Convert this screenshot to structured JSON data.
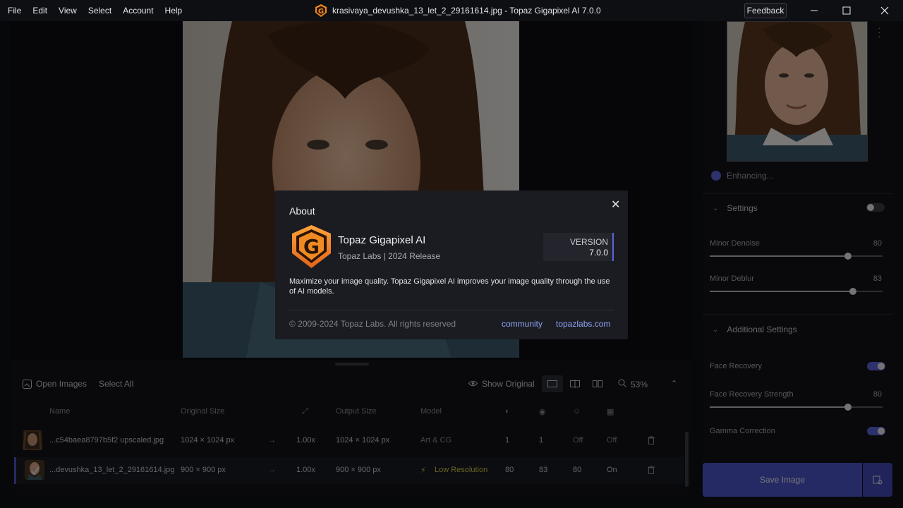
{
  "menu": [
    "File",
    "Edit",
    "View",
    "Select",
    "Account",
    "Help"
  ],
  "window": {
    "title": "krasivaya_devushka_13_let_2_29161614.jpg - Topaz Gigapixel AI 7.0.0",
    "feedback": "Feedback"
  },
  "colors": {
    "accent": "#5a63d8",
    "brand_orange": "#f08a22",
    "link": "#8ea4f5"
  },
  "right": {
    "status": "Enhancing...",
    "settings_title": "Settings",
    "minor_denoise": {
      "label": "Minor Denoise",
      "value": "80",
      "level": 0.8
    },
    "minor_deblur": {
      "label": "Minor Deblur",
      "value": "83",
      "level": 0.83
    },
    "additional_title": "Additional Settings",
    "face_recovery": {
      "label": "Face Recovery",
      "on": true
    },
    "face_strength": {
      "label": "Face Recovery Strength",
      "value": "80",
      "level": 0.8
    },
    "gamma": {
      "label": "Gamma Correction",
      "on": true
    },
    "save": "Save Image"
  },
  "bottom": {
    "open_images": "Open Images",
    "select_all": "Select All",
    "show_original": "Show Original",
    "zoom": "53%",
    "columns": {
      "name": "Name",
      "original": "Original Size",
      "output": "Output Size",
      "model": "Model"
    },
    "rows": [
      {
        "name": "...c54baea8797b5f2 upscaled.jpg",
        "original": "1024 × 1024 px",
        "scale": "1.00x",
        "output": "1024 × 1024 px",
        "model": "Art & CG",
        "c1": "1",
        "c2": "1",
        "c3": "Off",
        "c4": "Off"
      },
      {
        "name": "...devushka_13_let_2_29161614.jpg",
        "original": "900 × 900 px",
        "scale": "1.00x",
        "output": "900 × 900 px",
        "model": "Low Resolution",
        "c1": "80",
        "c2": "83",
        "c3": "80",
        "c4": "On"
      }
    ]
  },
  "about": {
    "title": "About",
    "product": "Topaz Gigapixel AI",
    "subtitle": "Topaz Labs | 2024 Release",
    "version_label": "VERSION",
    "version": "7.0.0",
    "description": "Maximize your image quality. Topaz Gigapixel AI improves your image quality through the use of AI models.",
    "copyright": "© 2009-2024 Topaz Labs. All rights reserved",
    "link_community": "community",
    "link_site": "topazlabs.com"
  }
}
